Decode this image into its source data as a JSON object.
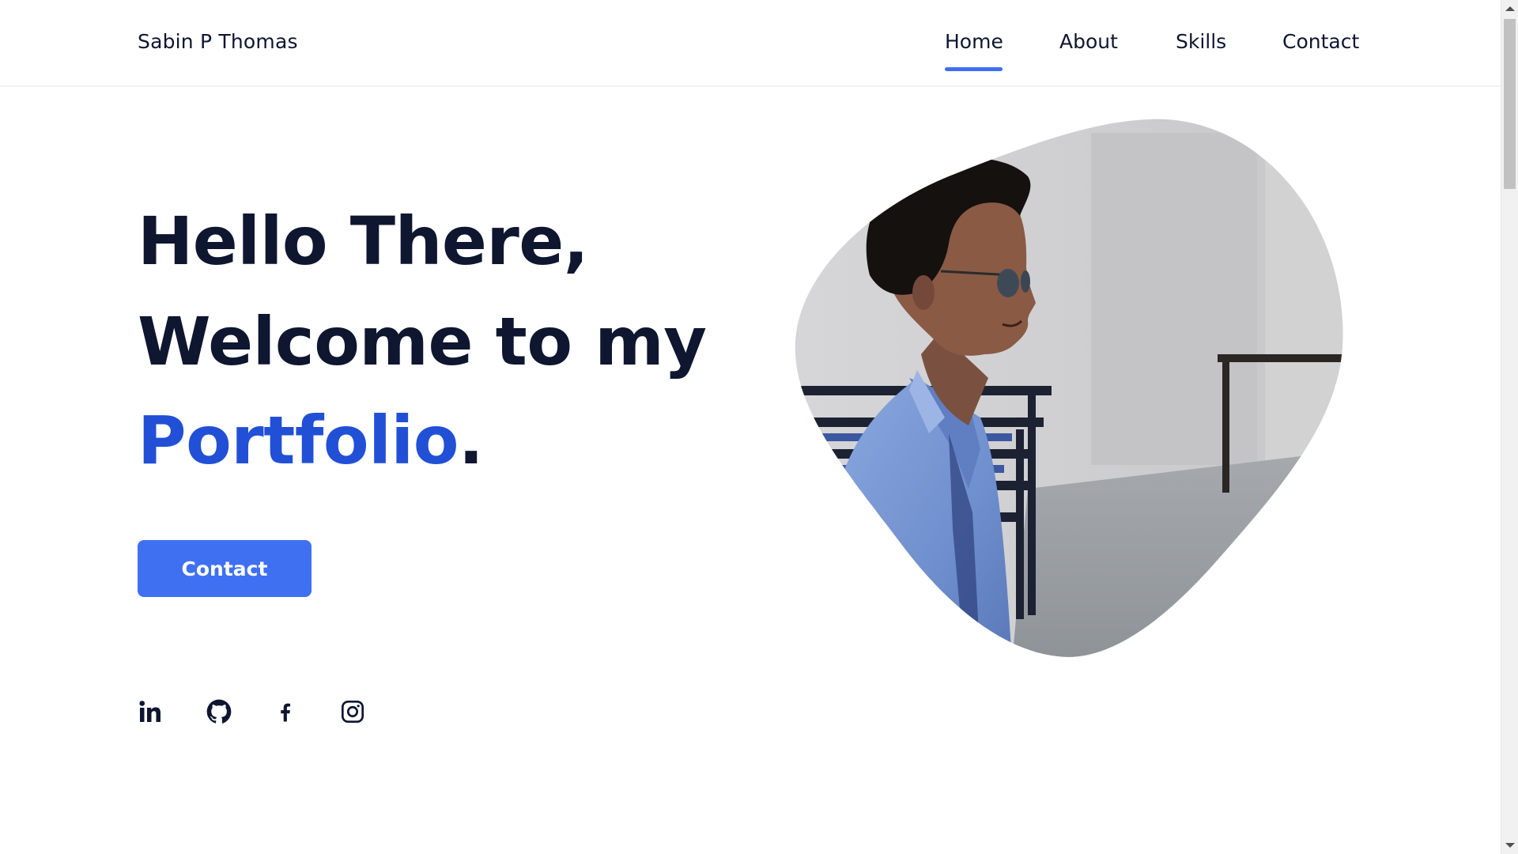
{
  "header": {
    "brand": "Sabin P Thomas",
    "nav": [
      {
        "label": "Home",
        "active": true
      },
      {
        "label": "About"
      },
      {
        "label": "Skills"
      },
      {
        "label": "Contact"
      }
    ]
  },
  "hero": {
    "line1": "Hello There,",
    "line2": "Welcome to my",
    "line3_accent": "Portfolio",
    "line3_end": ".",
    "button_label": "Contact"
  },
  "socials": [
    {
      "icon": "linkedin-icon"
    },
    {
      "icon": "github-icon"
    },
    {
      "icon": "facebook-icon"
    },
    {
      "icon": "instagram-icon"
    }
  ],
  "colors": {
    "accent": "#3f70f2",
    "accent_text": "#2150d6",
    "heading": "#0e1630"
  }
}
